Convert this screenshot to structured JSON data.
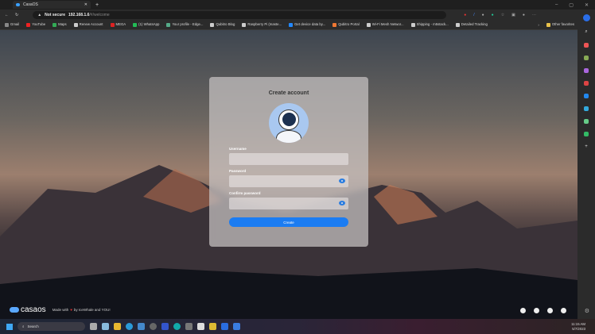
{
  "browser": {
    "tab_title": "CasaOS",
    "security": "Not secure",
    "url_host": "192.168.1.6",
    "url_path": "/#/welcome",
    "bookmarks": [
      "Gmail",
      "YouTube",
      "Maps",
      "Renew Account",
      "MEGA",
      "(1) WhatsApp",
      "Your profile - Edge...",
      "Qubitro Blog",
      "Raspberry Pi (maste...",
      "Get device data by...",
      "Qubitro Portal",
      "Wi-Fi Mesh Networ...",
      "Shipping - m5stack...",
      "Detailed Tracking"
    ],
    "other_favorites": "Other favorites"
  },
  "card": {
    "title": "Create account",
    "username_label": "Username",
    "password_label": "Password",
    "confirm_label": "Confirm password",
    "create_label": "Create"
  },
  "footer": {
    "logo": "casaos",
    "made_with": "Made with",
    "by": "by IceWhale and YOU!"
  },
  "taskbar": {
    "search": "Search",
    "time": "11:15 AM",
    "date": "5/7/2023"
  },
  "colors": {
    "accent": "#1b7cf2"
  }
}
